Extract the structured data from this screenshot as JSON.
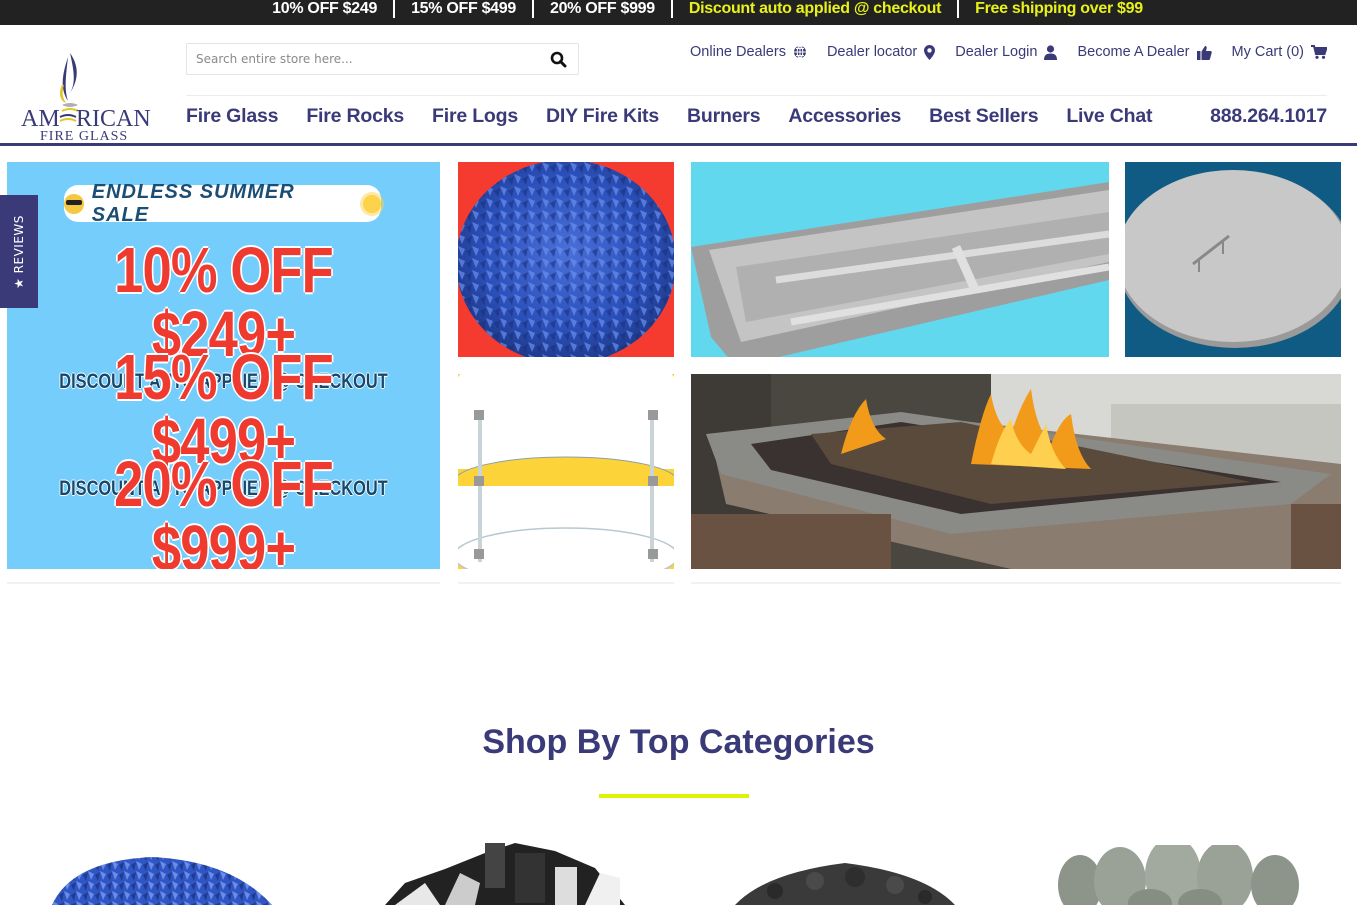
{
  "promo_bar": {
    "items": [
      {
        "text": "10% OFF $249",
        "color": "white"
      },
      {
        "text": "15% OFF $499",
        "color": "white"
      },
      {
        "text": "20% OFF $999",
        "color": "white"
      },
      {
        "text": "Discount auto applied @ checkout",
        "color": "yellow"
      },
      {
        "text": "Free shipping over $99",
        "color": "yellow"
      }
    ]
  },
  "brand": {
    "name_line1": "AMERICAN",
    "name_line2": "FIRE GLASS",
    "colors": {
      "navy": "#3a3a78",
      "yellow": "#e8f21a",
      "accent_rule": "#dff200"
    }
  },
  "search": {
    "placeholder": "Search entire store here...",
    "value": "",
    "icon": "search-icon"
  },
  "util_nav": [
    {
      "label": "Online Dealers",
      "icon": "globe-icon"
    },
    {
      "label": "Dealer locator",
      "icon": "map-marker-icon"
    },
    {
      "label": "Dealer Login",
      "icon": "user-icon"
    },
    {
      "label": "Become A Dealer",
      "icon": "thumbs-up-icon"
    },
    {
      "label": "My Cart (0)",
      "icon": "cart-icon"
    }
  ],
  "main_nav": [
    "Fire Glass",
    "Fire Rocks",
    "Fire Logs",
    "DIY Fire Kits",
    "Burners",
    "Accessories",
    "Best Sellers",
    "Live Chat"
  ],
  "phone": "888.264.1017",
  "reviews_tab": "★ REVIEWS",
  "hero": {
    "sale_banner": {
      "headline": "ENDLESS SUMMER SALE",
      "offers": [
        {
          "big": "10% OFF $249+",
          "small": "DISCOUNT AUTO APPLIED @ CHECKOUT"
        },
        {
          "big": "15% OFF $499+",
          "small": "DISCOUNT AUTO APPLIED @ CHECKOUT"
        },
        {
          "big": "20% OFF $999+",
          "small": "DISCOUNT AUTO APPLIED @ CHECKOUT"
        }
      ]
    },
    "tiles": [
      {
        "name": "fire-glass-tile",
        "subject": "blue fire glass"
      },
      {
        "name": "burner-tile",
        "subject": "linear burner pan"
      },
      {
        "name": "lid-tile",
        "subject": "round burner cover"
      },
      {
        "name": "wind-guard-tile",
        "subject": "glass wind guard"
      },
      {
        "name": "fire-pit-tile",
        "subject": "outdoor fire table"
      }
    ]
  },
  "section": {
    "title_light": "Shop By ",
    "title_bold": "Top Categories"
  },
  "categories": [
    {
      "name": "fire-glass-category"
    },
    {
      "name": "reflective-glass-category"
    },
    {
      "name": "lava-rock-category"
    },
    {
      "name": "fire-balls-category"
    }
  ]
}
